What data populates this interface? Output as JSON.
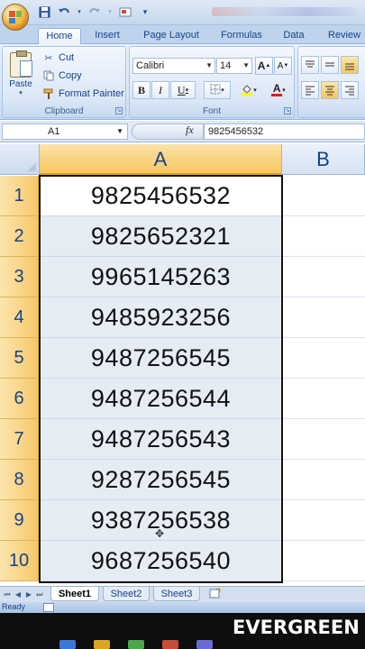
{
  "title_bar": {
    "blurred_title": ""
  },
  "qat": {
    "icons": [
      "save-icon",
      "undo-icon",
      "redo-icon",
      "print-preview-icon",
      "customize-icon"
    ]
  },
  "tabs": [
    "Home",
    "Insert",
    "Page Layout",
    "Formulas",
    "Data",
    "Review"
  ],
  "active_tab": "Home",
  "ribbon": {
    "clipboard": {
      "paste": "Paste",
      "cut": "Cut",
      "copy": "Copy",
      "format_painter": "Format Painter",
      "label": "Clipboard"
    },
    "font": {
      "name": "Calibri",
      "size": "14",
      "bold": "B",
      "italic": "I",
      "underline": "U",
      "grow": "A",
      "shrink": "A",
      "font_color": "A",
      "label": "Font"
    }
  },
  "formula_bar": {
    "name_box": "A1",
    "fx": "fx",
    "value": "9825456532"
  },
  "grid": {
    "columns": [
      "A",
      "B"
    ],
    "selected_column": "A",
    "rows": [
      {
        "row": "1",
        "A": "9825456532"
      },
      {
        "row": "2",
        "A": "9825652321"
      },
      {
        "row": "3",
        "A": "9965145263"
      },
      {
        "row": "4",
        "A": "9485923256"
      },
      {
        "row": "5",
        "A": "9487256545"
      },
      {
        "row": "6",
        "A": "9487256544"
      },
      {
        "row": "7",
        "A": "9487256543"
      },
      {
        "row": "8",
        "A": "9287256545"
      },
      {
        "row": "9",
        "A": "9387256538"
      },
      {
        "row": "10",
        "A": "9687256540"
      }
    ]
  },
  "sheets": {
    "tabs": [
      "Sheet1",
      "Sheet2",
      "Sheet3"
    ],
    "active": "Sheet1"
  },
  "status": {
    "text": "Ready"
  },
  "watermark": {
    "text": "EVERGREEN"
  },
  "colors": {
    "selection_header": "#f7c86a",
    "selected_range": "#e6ecf4",
    "ribbon": "#dbe7f6"
  }
}
